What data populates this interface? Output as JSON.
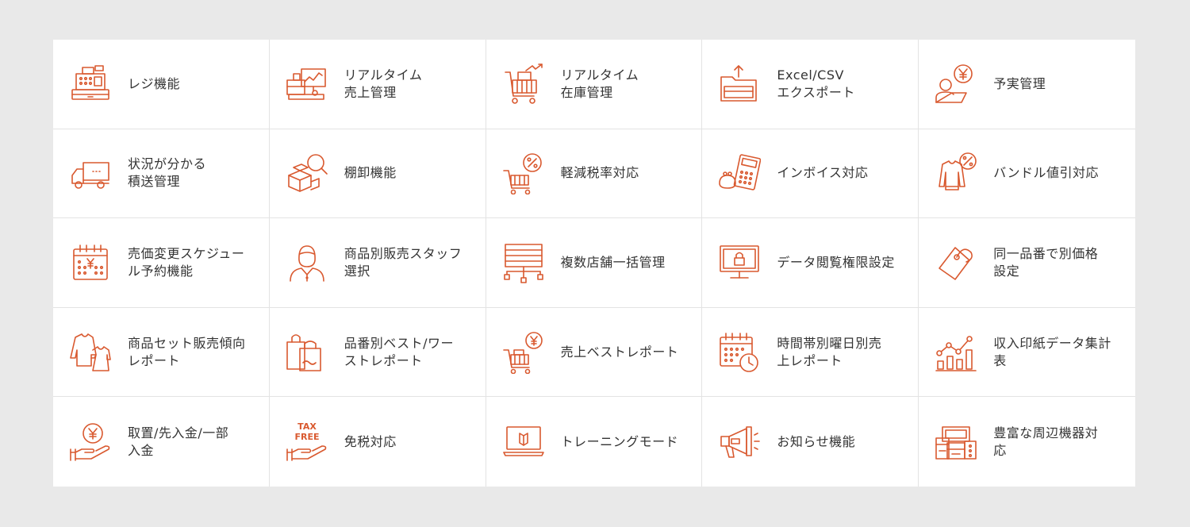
{
  "accent_color": "#d9592f",
  "features": [
    {
      "icon": "cash-register-icon",
      "label": "レジ機能"
    },
    {
      "icon": "realtime-sales-monitor-icon",
      "label": "リアルタイム\n売上管理"
    },
    {
      "icon": "inventory-cart-icon",
      "label": "リアルタイム\n在庫管理"
    },
    {
      "icon": "folder-export-icon",
      "label": "Excel/CSV\nエクスポート"
    },
    {
      "icon": "budget-yen-person-icon",
      "label": "予実管理"
    },
    {
      "icon": "delivery-truck-icon",
      "label": "状況が分かる\n積送管理"
    },
    {
      "icon": "stocktake-magnifier-icon",
      "label": "棚卸機能"
    },
    {
      "icon": "tax-cart-percent-icon",
      "label": "軽減税率対応"
    },
    {
      "icon": "invoice-calculator-icon",
      "label": "インボイス対応"
    },
    {
      "icon": "bundle-discount-sweater-icon",
      "label": "バンドル値引対応"
    },
    {
      "icon": "scheduled-price-calendar-icon",
      "label": "売価変更スケジュー\nル予約機能"
    },
    {
      "icon": "sales-staff-icon",
      "label": "商品別販売スタッフ\n選択"
    },
    {
      "icon": "multi-store-network-icon",
      "label": "複数店舗一括管理"
    },
    {
      "icon": "data-access-lock-monitor-icon",
      "label": "データ閲覧権限設定"
    },
    {
      "icon": "price-tag-icon",
      "label": "同一品番で別価格\n設定"
    },
    {
      "icon": "product-set-clothes-icon",
      "label": "商品セット販売傾向\nレポート"
    },
    {
      "icon": "best-worst-bags-icon",
      "label": "品番別ベスト/ワー\nストレポート"
    },
    {
      "icon": "best-sales-cart-yen-icon",
      "label": "売上ベストレポート"
    },
    {
      "icon": "time-day-calendar-clock-icon",
      "label": "時間帯別曜日別売\n上レポート"
    },
    {
      "icon": "revenue-stamp-chart-icon",
      "label": "収入印紙データ集計\n表"
    },
    {
      "icon": "deposit-yen-hand-icon",
      "label": "取置/先入金/一部\n入金"
    },
    {
      "icon": "tax-free-hand-icon",
      "label": "免税対応"
    },
    {
      "icon": "training-laptop-icon",
      "label": "トレーニングモード"
    },
    {
      "icon": "announcement-megaphone-icon",
      "label": "お知らせ機能"
    },
    {
      "icon": "peripheral-devices-icon",
      "label": "豊富な周辺機器対\n応"
    }
  ],
  "tax_free_icon_text": {
    "line1": "TAX",
    "line2": "FREE"
  }
}
